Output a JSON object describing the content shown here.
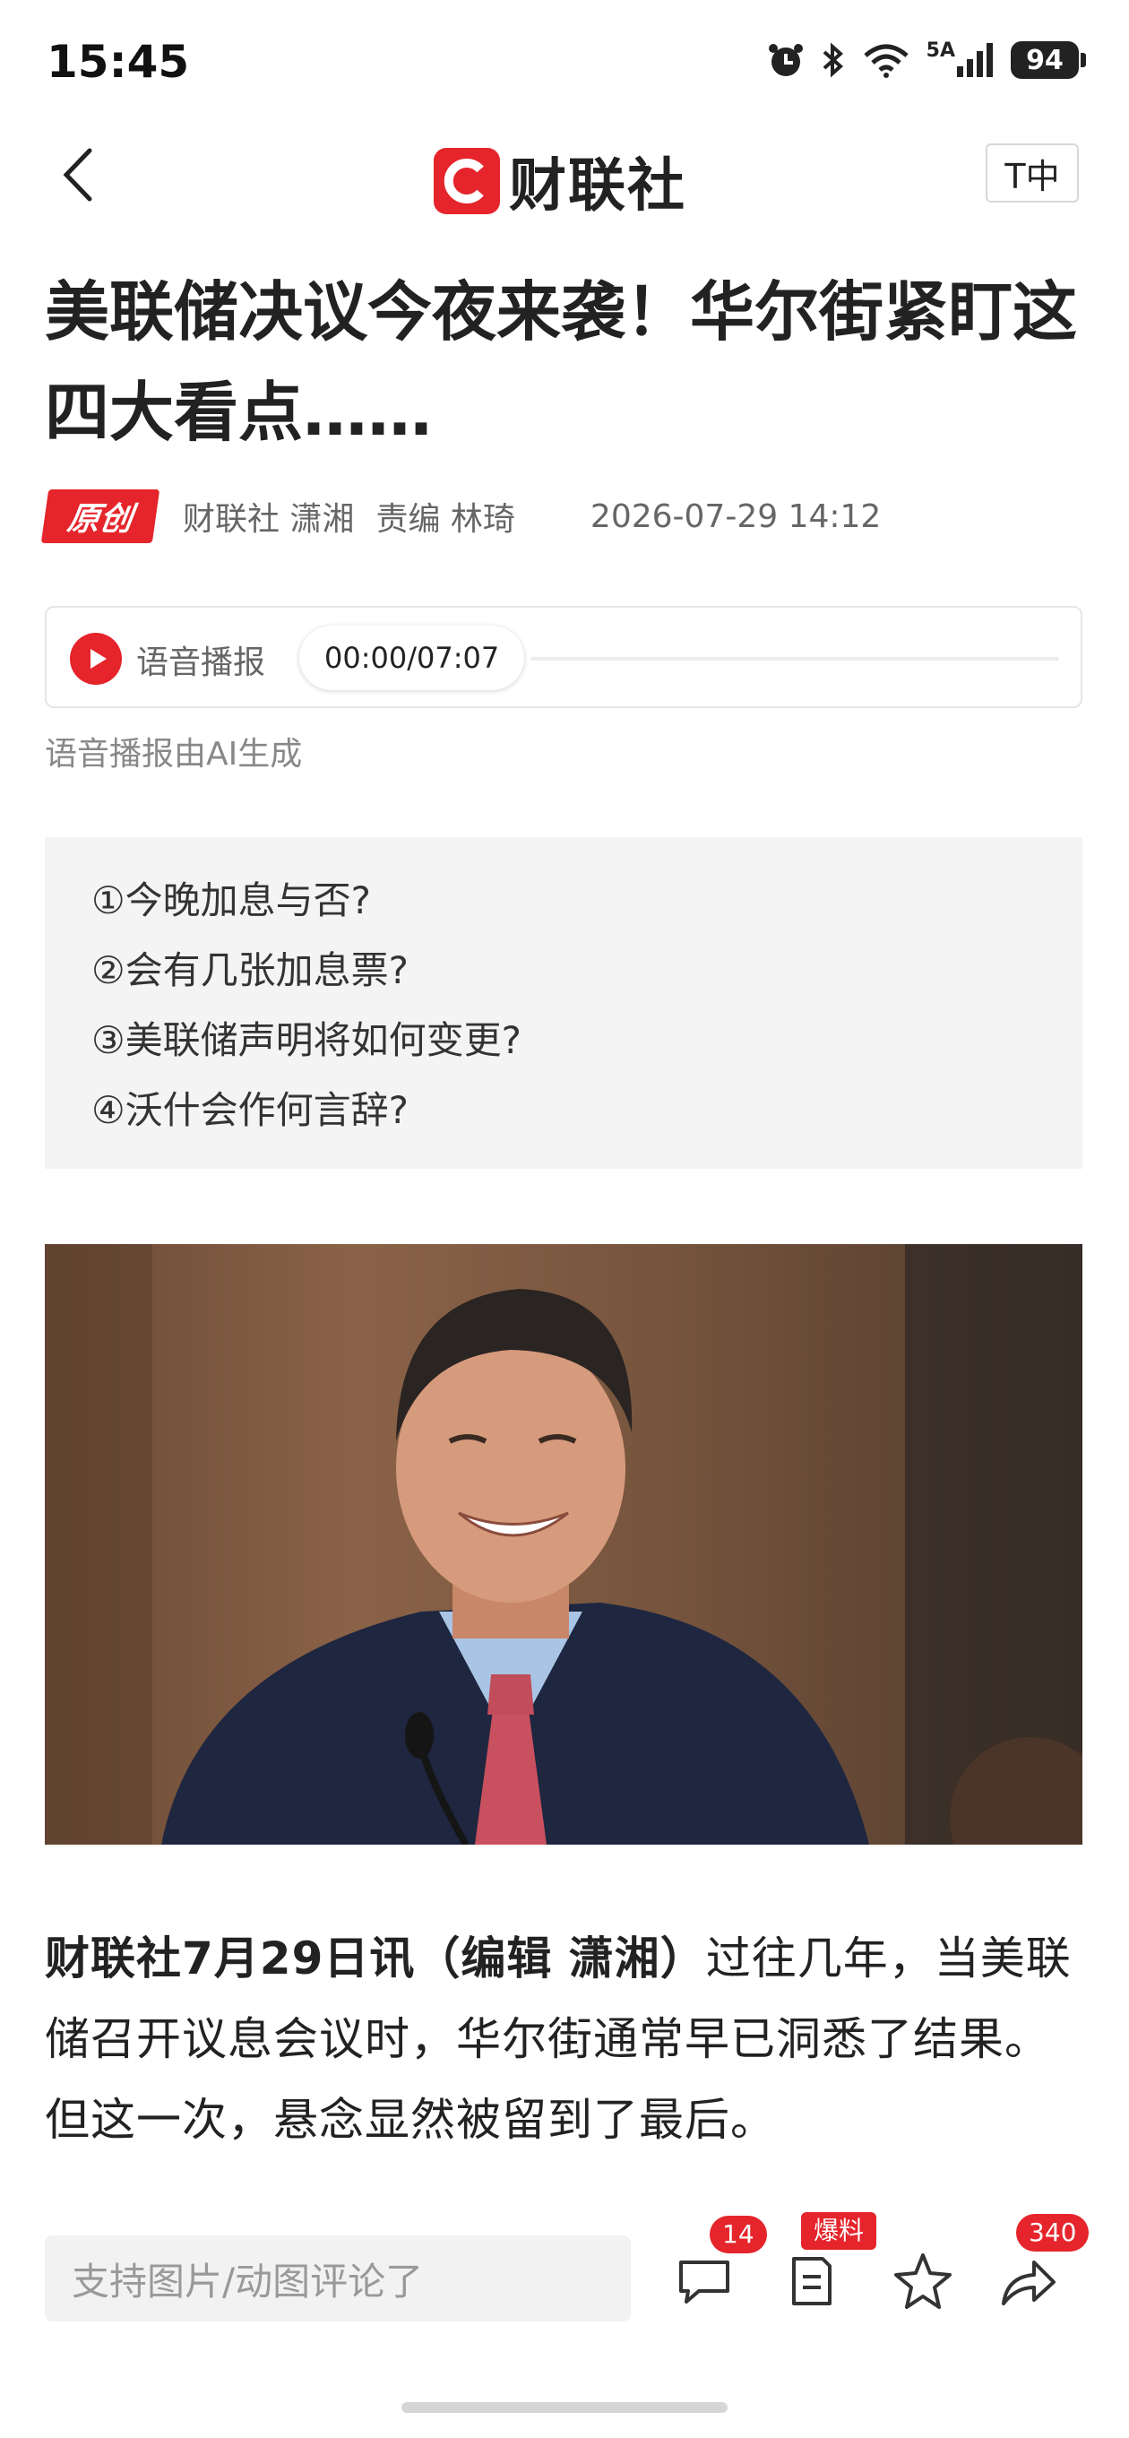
{
  "status_bar": {
    "time": "15:45",
    "network": "5A",
    "battery": "94",
    "icons": [
      "alarm-icon",
      "bluetooth-icon",
      "wifi-icon",
      "signal-icon",
      "battery-icon"
    ]
  },
  "nav": {
    "logo_text": "财联社",
    "font_size_label": "T中",
    "brand_color": "#e5242b"
  },
  "article": {
    "headline": "美联储决议今夜来袭！华尔街紧盯这四大看点……",
    "badge": "原创",
    "author": "财联社 潇湘",
    "editor": "责编 林琦",
    "datetime": "2026-07-29 14:12",
    "audio": {
      "label": "语音播报",
      "time": "00:00/07:07",
      "note": "语音播报由AI生成"
    },
    "summary_items": [
      "①今晚加息与否?",
      "②会有几张加息票?",
      "③美联储声明将如何变更?",
      "④沃什会作何言辞?"
    ],
    "lead": "财联社7月29日讯（编辑 潇湘）",
    "body": "过往几年，当美联储召开议息会议时，华尔街通常早已洞悉了结果。但这一次，悬念显然被留到了最后。"
  },
  "bottom_bar": {
    "comment_placeholder": "支持图片/动图评论了",
    "comment_count": "14",
    "report_label": "爆料",
    "share_count": "340"
  }
}
